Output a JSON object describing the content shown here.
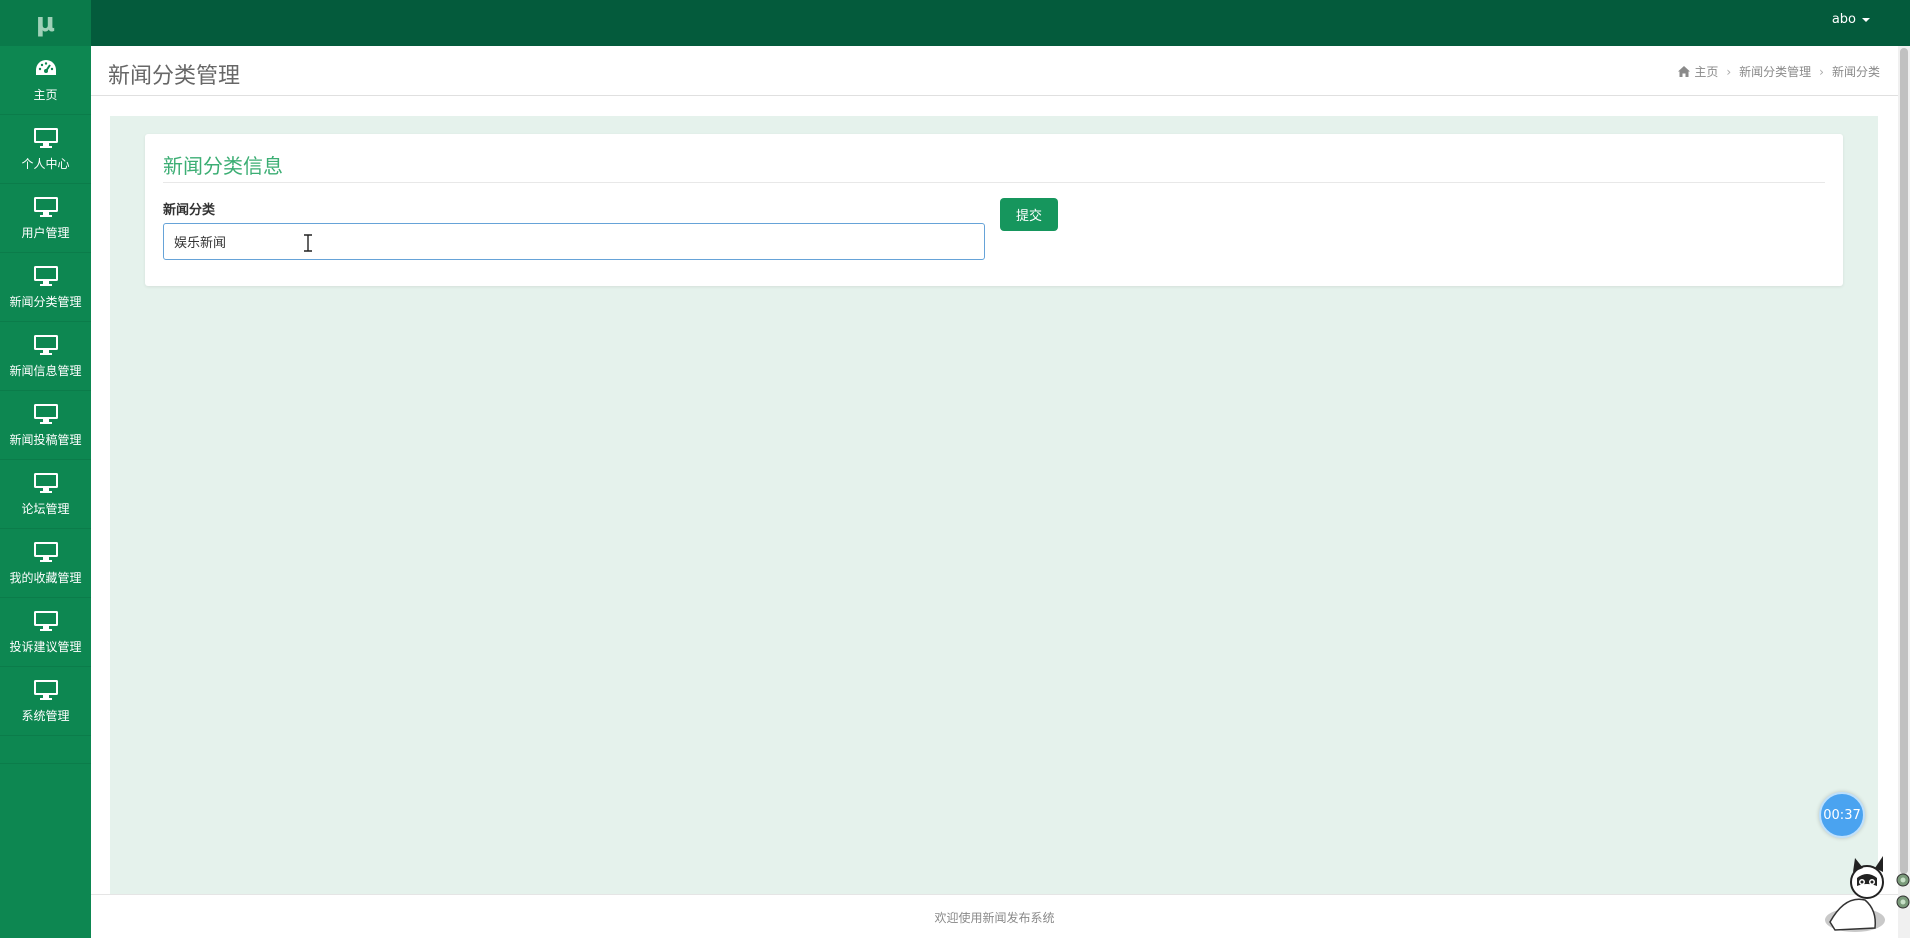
{
  "app": {
    "logo": "μ"
  },
  "topbar": {
    "username": "abo"
  },
  "sidebar": {
    "items": [
      {
        "label": "主页",
        "icon": "dashboard-icon"
      },
      {
        "label": "个人中心",
        "icon": "monitor-icon"
      },
      {
        "label": "用户管理",
        "icon": "monitor-icon"
      },
      {
        "label": "新闻分类管理",
        "icon": "monitor-icon"
      },
      {
        "label": "新闻信息管理",
        "icon": "monitor-icon"
      },
      {
        "label": "新闻投稿管理",
        "icon": "monitor-icon"
      },
      {
        "label": "论坛管理",
        "icon": "monitor-icon"
      },
      {
        "label": "我的收藏管理",
        "icon": "monitor-icon"
      },
      {
        "label": "投诉建议管理",
        "icon": "monitor-icon"
      },
      {
        "label": "系统管理",
        "icon": "monitor-icon"
      }
    ]
  },
  "header": {
    "title": "新闻分类管理",
    "breadcrumb": [
      "主页",
      "新闻分类管理",
      "新闻分类"
    ]
  },
  "form": {
    "title": "新闻分类信息",
    "field_label": "新闻分类",
    "field_value": "娱乐新闻",
    "submit_label": "提交"
  },
  "footer": {
    "text": "欢迎使用新闻发布系统"
  },
  "timer": {
    "value": "00:37"
  },
  "colors": {
    "topbar": "#045b3c",
    "sidebar": "#0d8751",
    "accent": "#3cae74",
    "button": "#16965d",
    "content_bg": "#e5f2ec"
  }
}
